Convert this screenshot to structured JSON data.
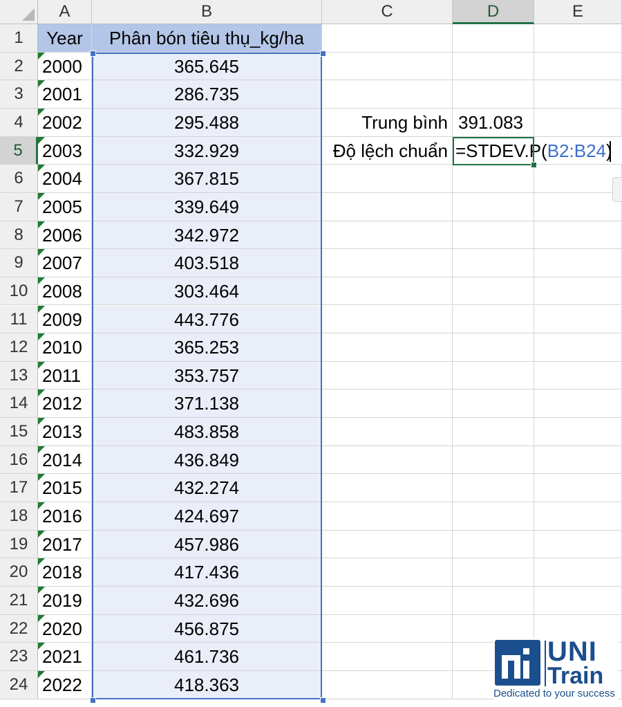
{
  "columns": [
    "A",
    "B",
    "C",
    "D",
    "E"
  ],
  "active_column": "D",
  "active_row": "5",
  "header_row": {
    "year": "Year",
    "fertilizer": "Phân bón tiêu thụ_kg/ha"
  },
  "rows": [
    {
      "num": "2",
      "year": "2000",
      "value": "365.645"
    },
    {
      "num": "3",
      "year": "2001",
      "value": "286.735"
    },
    {
      "num": "4",
      "year": "2002",
      "value": "295.488"
    },
    {
      "num": "5",
      "year": "2003",
      "value": "332.929"
    },
    {
      "num": "6",
      "year": "2004",
      "value": "367.815"
    },
    {
      "num": "7",
      "year": "2005",
      "value": "339.649"
    },
    {
      "num": "8",
      "year": "2006",
      "value": "342.972"
    },
    {
      "num": "9",
      "year": "2007",
      "value": "403.518"
    },
    {
      "num": "10",
      "year": "2008",
      "value": "303.464"
    },
    {
      "num": "11",
      "year": "2009",
      "value": "443.776"
    },
    {
      "num": "12",
      "year": "2010",
      "value": "365.253"
    },
    {
      "num": "13",
      "year": "2011",
      "value": "353.757"
    },
    {
      "num": "14",
      "year": "2012",
      "value": "371.138"
    },
    {
      "num": "15",
      "year": "2013",
      "value": "483.858"
    },
    {
      "num": "16",
      "year": "2014",
      "value": "436.849"
    },
    {
      "num": "17",
      "year": "2015",
      "value": "432.274"
    },
    {
      "num": "18",
      "year": "2016",
      "value": "424.697"
    },
    {
      "num": "19",
      "year": "2017",
      "value": "457.986"
    },
    {
      "num": "20",
      "year": "2018",
      "value": "417.436"
    },
    {
      "num": "21",
      "year": "2019",
      "value": "432.696"
    },
    {
      "num": "22",
      "year": "2020",
      "value": "456.875"
    },
    {
      "num": "23",
      "year": "2021",
      "value": "461.736"
    },
    {
      "num": "24",
      "year": "2022",
      "value": "418.363"
    }
  ],
  "stats": {
    "mean_label": "Trung bình",
    "mean_value": "391.083",
    "std_label": "Độ lệch chuẩn",
    "formula_prefix": "=STDEV.P(",
    "formula_range": "B2:B24",
    "formula_suffix": ")"
  },
  "logo": {
    "brand_top": "UNI",
    "brand_bottom": "Train",
    "tagline": "Dedicated to your success"
  },
  "colors": {
    "header_fill": "#b4c6e7",
    "selection_fill": "#e9eef8",
    "selection_border": "#4472c4",
    "active_green": "#217346",
    "range_ref": "#3d6fc9",
    "brand": "#1b4e8c"
  }
}
